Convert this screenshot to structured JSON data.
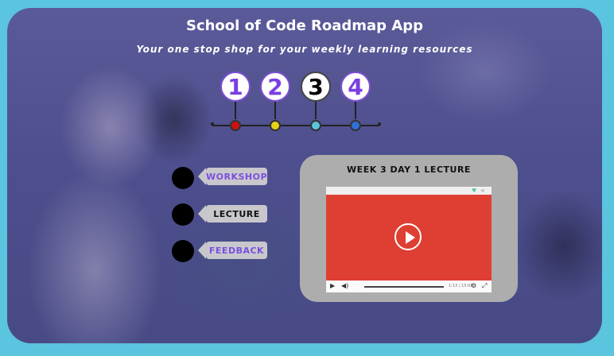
{
  "header": {
    "title": "School of Code Roadmap App",
    "subtitle": "Your one stop shop for your weekly learning resources"
  },
  "weeks": [
    {
      "label": "1",
      "dot_color": "#cc1111",
      "active": false
    },
    {
      "label": "2",
      "dot_color": "#e6d219",
      "active": false
    },
    {
      "label": "3",
      "dot_color": "#5bc4de",
      "active": true
    },
    {
      "label": "4",
      "dot_color": "#2f6fd8",
      "active": false
    }
  ],
  "nav": [
    {
      "label": "WORKSHOP",
      "color": "#7a4fe0"
    },
    {
      "label": "LECTURE",
      "color": "#111111"
    },
    {
      "label": "FEEDBACK",
      "color": "#7a4fe0"
    }
  ],
  "video": {
    "title": "WEEK 3 DAY 1 LECTURE",
    "time": "1:13 / 15:08",
    "icons": {
      "like": "heart-icon",
      "share": "share-icon",
      "play": "play-icon",
      "volume": "volume-icon",
      "settings": "gear-icon",
      "fullscreen": "fullscreen-icon"
    }
  }
}
